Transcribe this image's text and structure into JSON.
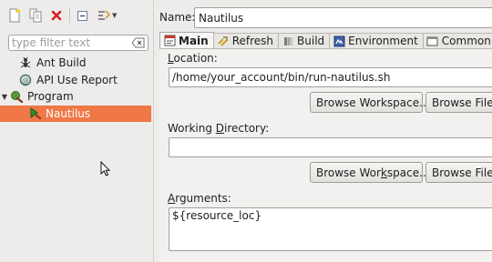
{
  "toolbar": {
    "buttons": [
      {
        "icon": "new-config-icon"
      },
      {
        "icon": "duplicate-icon"
      },
      {
        "icon": "delete-icon"
      },
      {
        "icon": "collapse-all-icon"
      },
      {
        "icon": "filter-icon"
      }
    ]
  },
  "filter": {
    "placeholder": "type filter text",
    "value": ""
  },
  "tree": {
    "items": [
      {
        "label": "Ant Build",
        "icon": "ant-build-icon",
        "expanded": null,
        "selected": false
      },
      {
        "label": "API Use Report",
        "icon": "api-report-icon",
        "expanded": null,
        "selected": false
      },
      {
        "label": "Program",
        "icon": "program-icon",
        "expanded": true,
        "selected": false
      },
      {
        "label": "Nautilus",
        "icon": "program-config-icon",
        "expanded": null,
        "selected": true
      }
    ]
  },
  "form": {
    "name_label": "Name:",
    "name_value": "Nautilus"
  },
  "tabs": [
    {
      "label": "Main",
      "icon": "main-tab-icon",
      "active": true
    },
    {
      "label": "Refresh",
      "icon": "refresh-tab-icon",
      "active": false
    },
    {
      "label": "Build",
      "icon": "build-tab-icon",
      "active": false
    },
    {
      "label": "Environment",
      "icon": "environment-tab-icon",
      "active": false
    },
    {
      "label": "Common",
      "icon": "common-tab-icon",
      "active": false
    }
  ],
  "main": {
    "location": {
      "label_pre": "",
      "label_mnemonic": "L",
      "label_post": "ocation:",
      "value": "/home/your_account/bin/run-nautilus.sh",
      "browse_workspace": "Browse Workspace...",
      "browse_file_system": "Browse File S"
    },
    "working_directory": {
      "label_pre": "Working ",
      "label_mnemonic": "D",
      "label_post": "irectory:",
      "value": "",
      "browse_workspace_pre": "Browse Wor",
      "browse_workspace_mnemonic": "k",
      "browse_workspace_post": "space...",
      "browse_file_system": "Browse File S"
    },
    "arguments": {
      "label_pre": "",
      "label_mnemonic": "A",
      "label_post": "rguments:",
      "value": "${resource_loc}"
    }
  },
  "colors": {
    "selection": "#f07746",
    "window_bg": "#edeceb"
  }
}
